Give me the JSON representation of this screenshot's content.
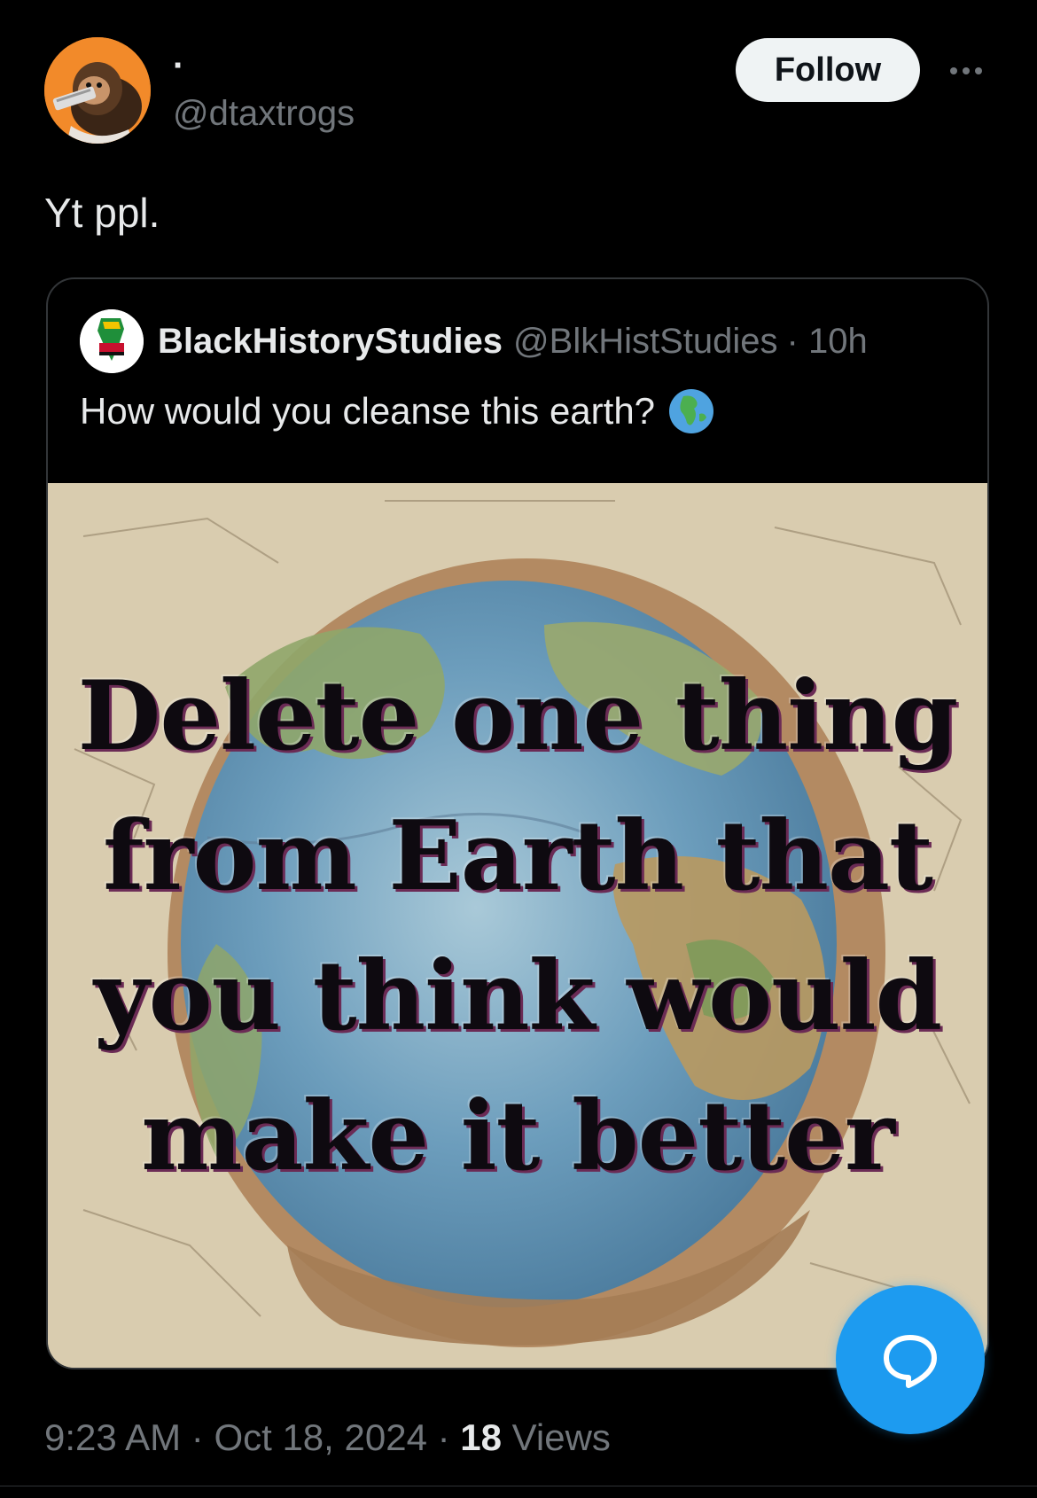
{
  "author": {
    "display_name": "·",
    "handle": "@dtaxtrogs",
    "avatar_icon": "caveman-avatar"
  },
  "actions": {
    "follow_label": "Follow",
    "more_icon": "more-horizontal-icon"
  },
  "tweet": {
    "text": "Yt ppl."
  },
  "quoted_tweet": {
    "display_name": "BlackHistoryStudies",
    "handle": "@BlkHistStudies",
    "age": "· 10h",
    "text": "How would you cleanse this earth?",
    "emoji_icon": "globe-africa-icon",
    "image": {
      "caption_lines": [
        "Delete one thing",
        "from Earth that",
        "you think would",
        "make it better"
      ]
    }
  },
  "meta": {
    "time": "9:23 AM",
    "date": "Oct 18, 2024",
    "views_count": "18",
    "views_label": "Views"
  },
  "colors": {
    "background": "#000000",
    "text_primary": "#e7e9ea",
    "text_secondary": "#71767b",
    "accent": "#1d9bf0",
    "border": "#333639"
  }
}
